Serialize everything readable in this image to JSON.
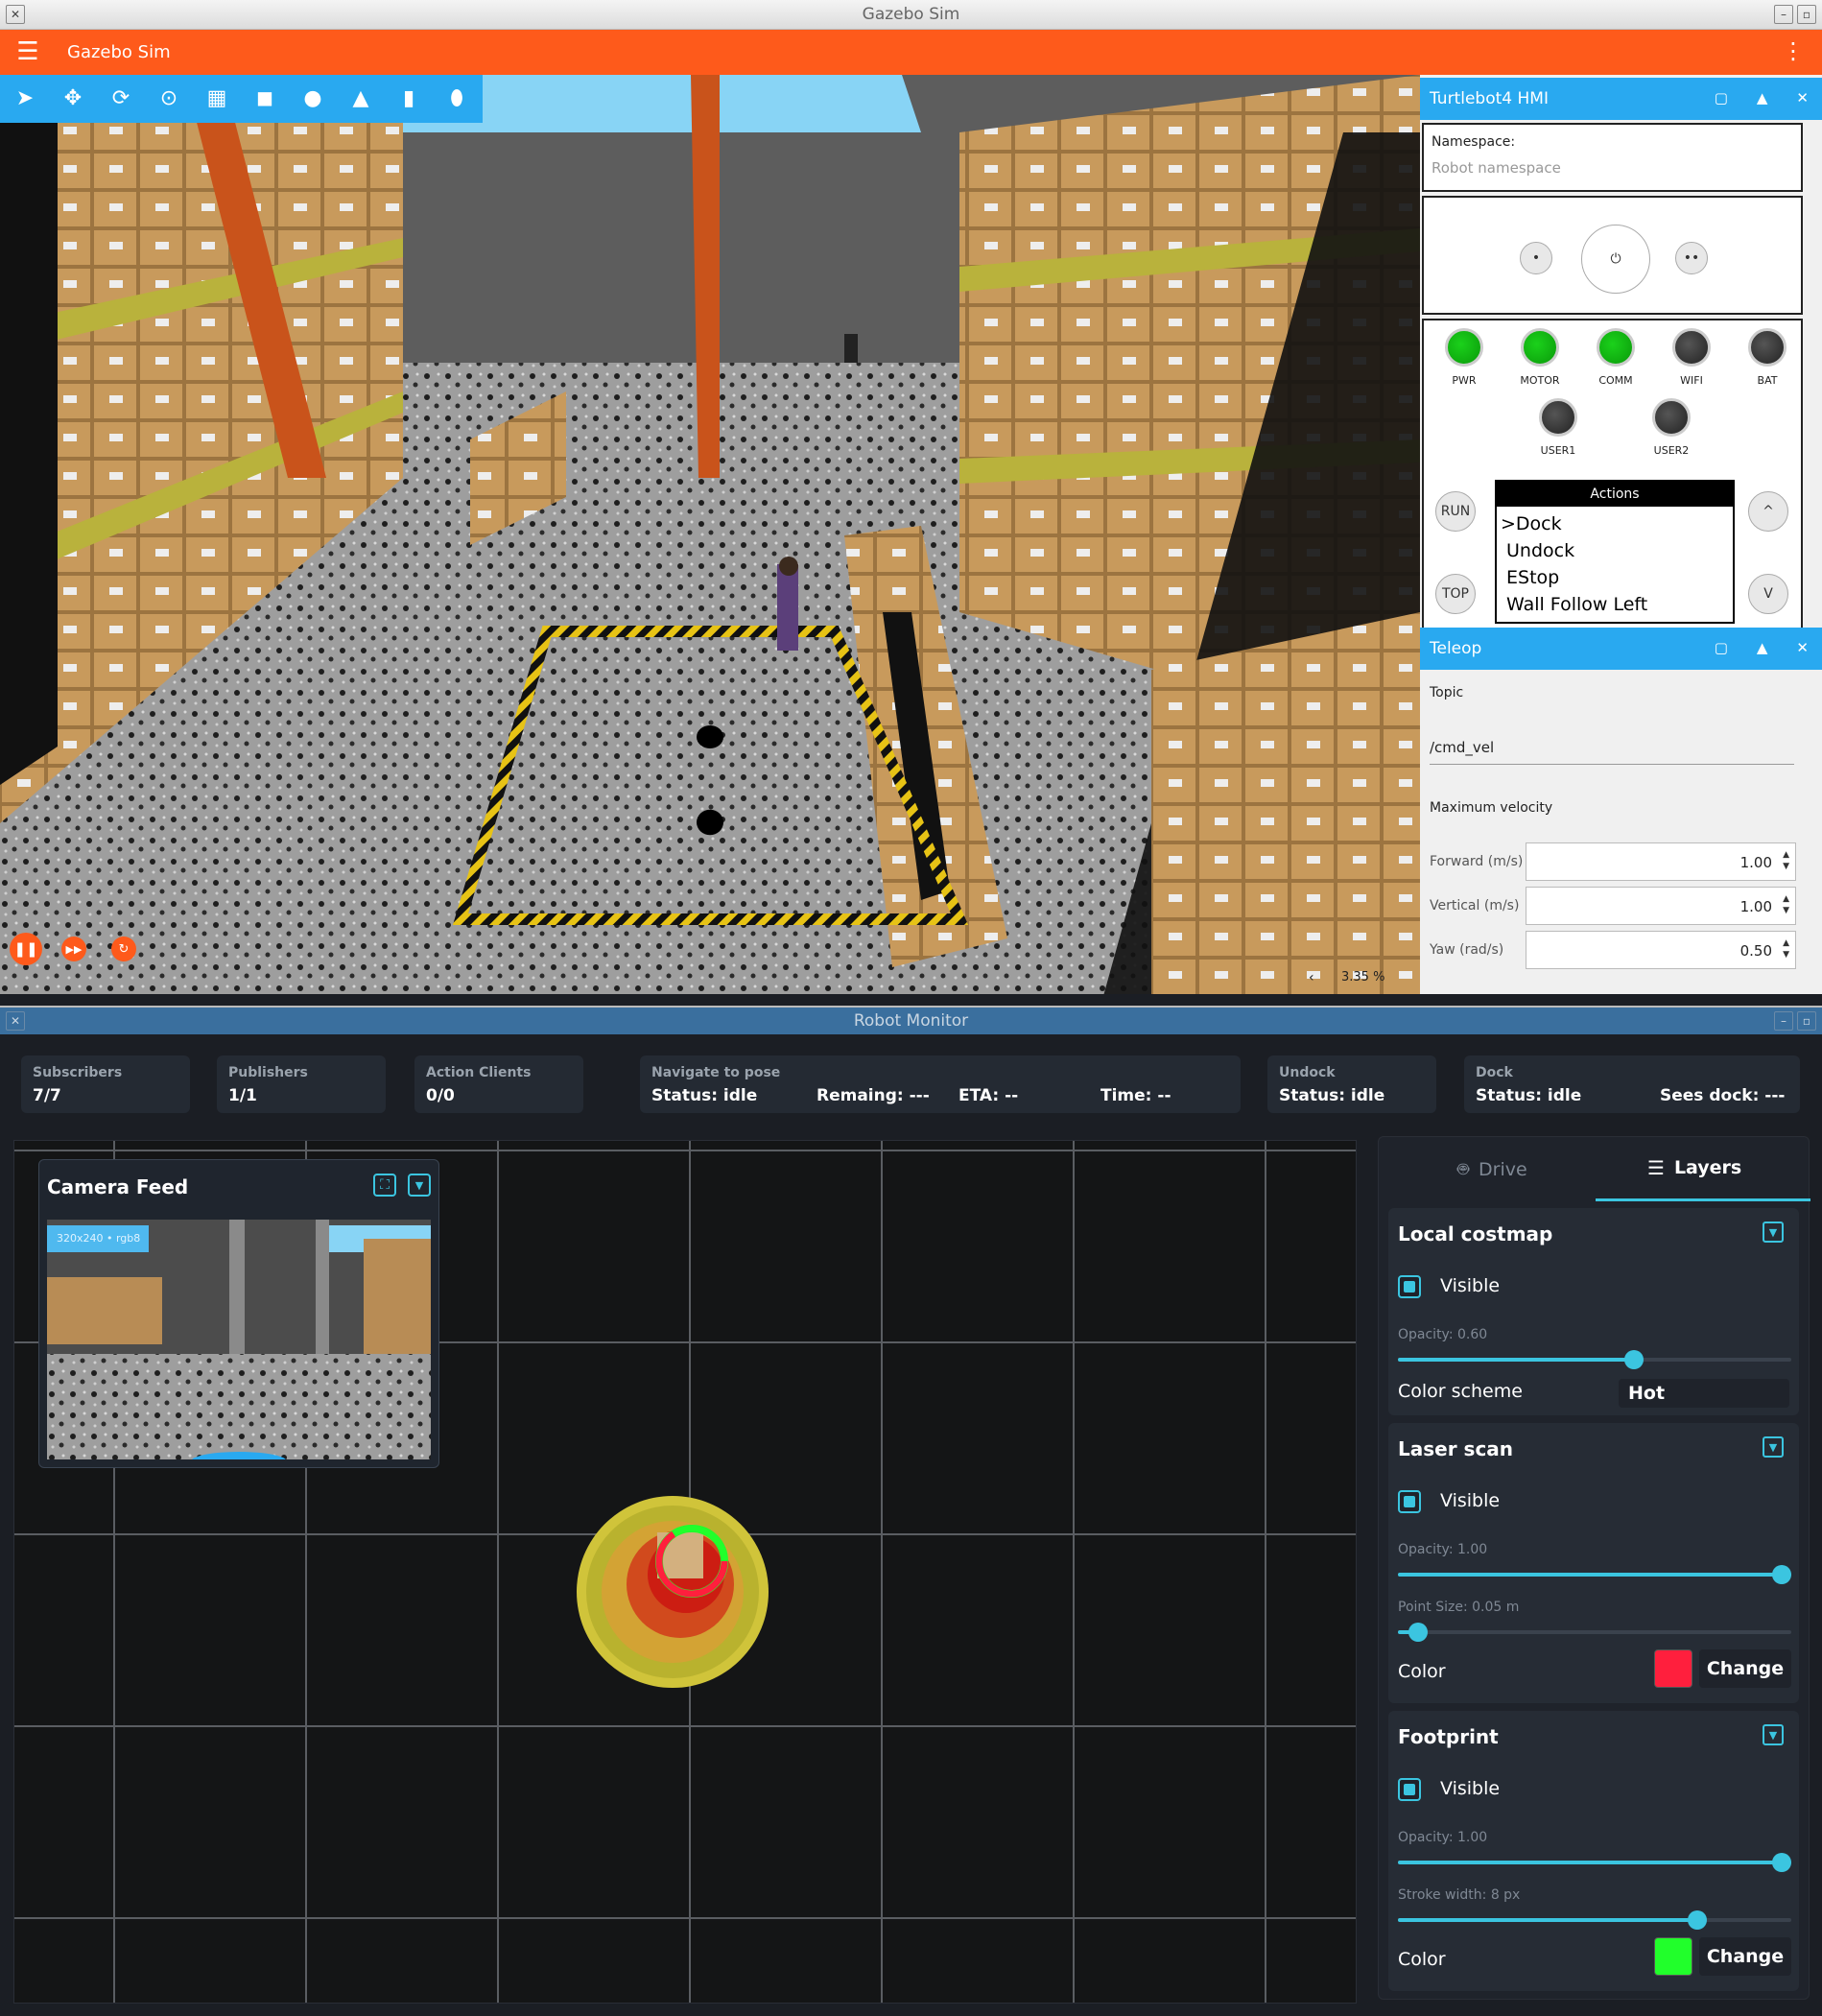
{
  "gazebo": {
    "window_title": "Gazebo Sim",
    "app_title": "Gazebo Sim",
    "rtf": "3.35 %",
    "hmi": {
      "title": "Turtlebot4 HMI",
      "namespace_label": "Namespace:",
      "namespace_placeholder": "Robot namespace",
      "leds": [
        {
          "label": "PWR",
          "on": true
        },
        {
          "label": "MOTOR",
          "on": true
        },
        {
          "label": "COMM",
          "on": true
        },
        {
          "label": "WIFI",
          "on": false
        },
        {
          "label": "BAT",
          "on": false
        },
        {
          "label": "USER1",
          "on": false
        },
        {
          "label": "USER2",
          "on": false
        }
      ],
      "run_label": "RUN",
      "top_label": "TOP",
      "up_label": "^",
      "down_label": "V",
      "actions_title": "Actions",
      "actions": [
        ">Dock",
        "Undock",
        "EStop",
        "Wall Follow Left"
      ]
    },
    "teleop": {
      "title": "Teleop",
      "topic_label": "Topic",
      "topic_value": "/cmd_vel",
      "max_velocity_label": "Maximum velocity",
      "forward_label": "Forward (m/s)",
      "forward_value": "1.00",
      "vertical_label": "Vertical (m/s)",
      "vertical_value": "1.00",
      "yaw_label": "Yaw (rad/s)",
      "yaw_value": "0.50"
    }
  },
  "monitor": {
    "window_title": "Robot Monitor",
    "stats": {
      "subscribers": {
        "label": "Subscribers",
        "value": "7/7"
      },
      "publishers": {
        "label": "Publishers",
        "value": "1/1"
      },
      "action_clients": {
        "label": "Action Clients",
        "value": "0/0"
      },
      "navigate": {
        "label": "Navigate to pose",
        "status": "Status:  idle",
        "remaining": "Remaing: ---",
        "eta": "ETA: --",
        "time": "Time: --"
      },
      "undock": {
        "label": "Undock",
        "status": "Status:  idle"
      },
      "dock": {
        "label": "Dock",
        "status": "Status:  idle",
        "sees": "Sees dock: ---"
      }
    },
    "camera": {
      "title": "Camera Feed",
      "overlay": "320x240 • rgb8"
    },
    "tabs": {
      "drive": "Drive",
      "layers": "Layers"
    },
    "layers": {
      "local_costmap": {
        "title": "Local costmap",
        "visible": "Visible",
        "opacity_label": "Opacity: 0.60",
        "opacity": 0.6,
        "scheme_label": "Color scheme",
        "scheme_value": "Hot"
      },
      "laser_scan": {
        "title": "Laser scan",
        "visible": "Visible",
        "opacity_label": "Opacity: 1.00",
        "opacity": 1.0,
        "point_size_label": "Point Size: 0.05 m",
        "point_size_fraction": 0.05,
        "color_label": "Color",
        "color": "#ff1f3d",
        "change": "Change"
      },
      "footprint": {
        "title": "Footprint",
        "visible": "Visible",
        "opacity_label": "Opacity: 1.00",
        "opacity": 1.0,
        "stroke_label": "Stroke width: 8 px",
        "stroke_fraction": 0.76,
        "color_label": "Color",
        "color": "#21ff2b",
        "change": "Change"
      }
    }
  },
  "colors": {
    "gazebo_orange": "#fe5a1b",
    "gazebo_blue": "#29a9f0",
    "accent_cyan": "#3bc5e0"
  }
}
